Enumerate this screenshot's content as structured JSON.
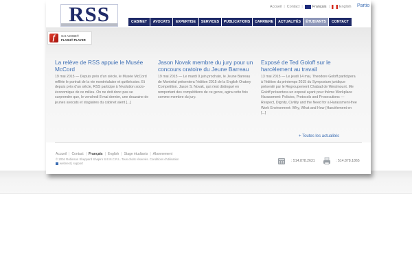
{
  "brand": {
    "logo_text": "RSS",
    "colors": {
      "navy": "#1f2a68",
      "active_tab": "#8d96b8",
      "link_blue": "#3b6db3"
    }
  },
  "utility": {
    "home": "Accueil",
    "contact": "Contact",
    "french": "Français",
    "english": "English",
    "partial_link": "Partio"
  },
  "nav": {
    "tabs": [
      {
        "label": "CABINET",
        "active": false
      },
      {
        "label": "AVOCATS",
        "active": false
      },
      {
        "label": "EXPERTISE",
        "active": false
      },
      {
        "label": "SERVICES",
        "active": false
      },
      {
        "label": "PUBLICATIONS",
        "active": false
      },
      {
        "label": "CARRIERE",
        "active": false
      },
      {
        "label": "ACTUALITÉS",
        "active": false
      },
      {
        "label": "ÉTUDIANTS",
        "active": true
      },
      {
        "label": "CONTACT",
        "active": false
      }
    ]
  },
  "flash_badge": {
    "icon": "flash-icon",
    "line1": "Get ADOBE®",
    "line2": "FLASH® PLAYER"
  },
  "articles": [
    {
      "title": "La relève de RSS appuie le Musée McCord",
      "body": "19 mai 2015 — Depuis près d'un siècle, le Musée McCord reflète le portrait de la vie montréalaise et québécoise. Et depuis près d'un siècle, RSS participe à l'évolution socio-économique de ce milieu. On ne doit donc pas se surprendre que, le vendredi 8 mai dernier, une douzaine de jeunes avocats et stagiaires du cabinet aient [...]"
    },
    {
      "title": "Jason Novak membre du jury pour un concours oratoire du Jeune Barreau",
      "body": "19 mai 2015 — Le mardi 9 juin prochain, le Jeune Barreau de Montréal présentera l'édition 2015 de la English Oratory Competition. Jason S. Novak, qui s'est distingué en remportant des compétitions de ce genre, agira cette fois comme membre du jury."
    },
    {
      "title": "Exposé de Ted Goloff sur le harcèlement au travail",
      "body": "13 mai 2015 — Le jeudi 14 mai, Theodore Goloff participera à l'édition du printemps 2015 du Symposium juridique présenté par le Regroupement Chabad de Westmount. Me Goloff présentera un exposé ayant pour thème Workplace Harassment: Policies, Protocols and Prosecutions — Respect, Dignity, Civility and the Need for a Harassment-free Work Environment: Why, What and How (Harcèlement en [...]"
    }
  ],
  "all_news_link": "+ Toutes les actualités",
  "footer": {
    "links": {
      "home": "Accueil",
      "contact": "Contact",
      "french": "Français",
      "english": "English",
      "internships": "Stage étudiants",
      "subscription": "Abonnement"
    },
    "copyright": "© 2004 Robinson Sheppard Shapiro S.E.N.C.R.L. Tous droits réservés. Conditions d'utilisation",
    "webnest": "webnest | support",
    "phone": ": 514.878.2631",
    "fax": ": 514.878.1865",
    "icons": {
      "phone": "phone-icon",
      "fax": "fax-icon",
      "webnest": "webnest-icon"
    }
  }
}
